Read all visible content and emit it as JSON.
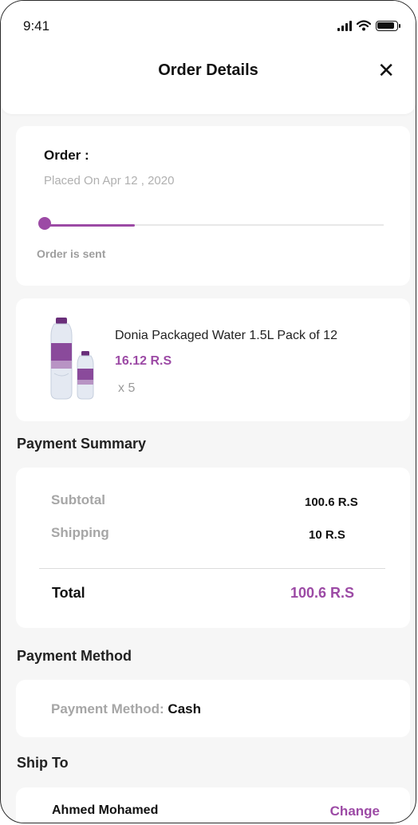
{
  "status_bar": {
    "time": "9:41"
  },
  "header": {
    "title": "Order Details",
    "close_icon": "close-icon"
  },
  "order": {
    "label": "Order :",
    "placed_on": "Placed On Apr 12 , 2020",
    "status_text": "Order is sent",
    "progress": 0.27,
    "accent_color": "#9c4aa5"
  },
  "product": {
    "name": "Donia Packaged Water 1.5L Pack of 12",
    "price": "16.12 R.S",
    "quantity": "x 5"
  },
  "payment_summary": {
    "heading": "Payment Summary",
    "rows": [
      {
        "label": "Subtotal",
        "value": "100.6 R.S"
      },
      {
        "label": "Shipping",
        "value": "10 R.S"
      }
    ],
    "total_label": "Total",
    "total_value": "100.6 R.S"
  },
  "payment_method": {
    "heading": "Payment Method",
    "label": "Payment Method:",
    "value": "Cash"
  },
  "ship_to": {
    "heading": "Ship To",
    "name": "Ahmed Mohamed",
    "change_label": "Change"
  }
}
